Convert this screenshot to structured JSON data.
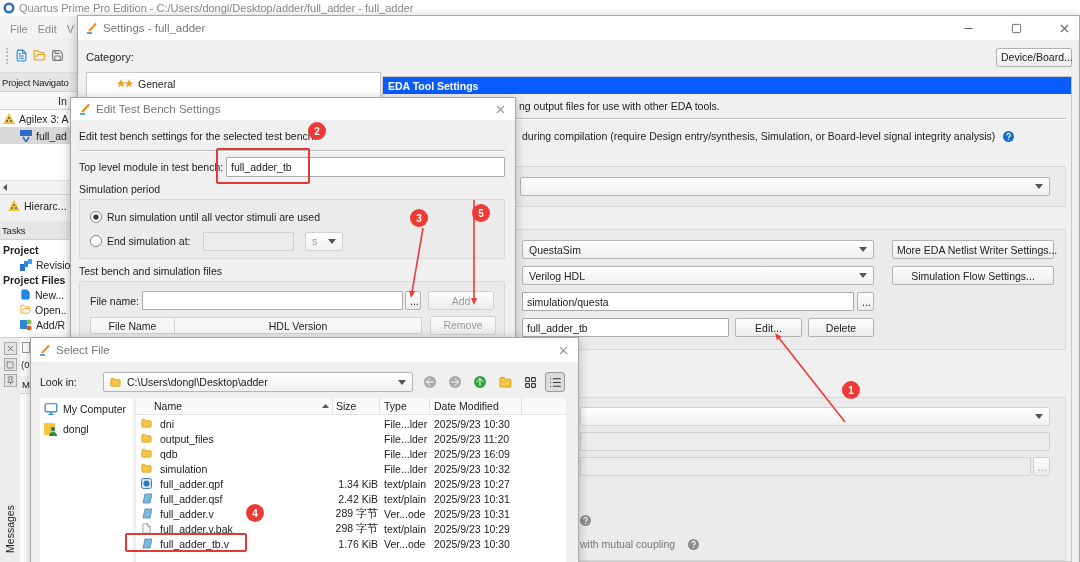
{
  "main_window": {
    "title": "Quartus Prime Pro Edition - C:/Users/dongl/Desktop/adder/full_adder - full_adder",
    "menu": [
      {
        "label": "File"
      },
      {
        "label": "Edit"
      },
      {
        "label": "V"
      }
    ],
    "navigator": {
      "title": "Project Navigato",
      "column": "In",
      "tab": "Hierarc...",
      "items": [
        {
          "label": "Agilex 3: A",
          "kind": "device",
          "selected": false
        },
        {
          "label": "full_ad",
          "kind": "entity",
          "selected": true
        }
      ]
    },
    "tasks": {
      "title": "Tasks",
      "items": [
        {
          "label": "Project",
          "kind": "heading"
        },
        {
          "label": "Revisio",
          "kind": "revisions"
        },
        {
          "label": "Project Files",
          "kind": "heading"
        },
        {
          "label": "New...",
          "kind": "new"
        },
        {
          "label": "Open..",
          "kind": "open"
        },
        {
          "label": "Add/R",
          "kind": "add"
        }
      ]
    },
    "messages": {
      "title": "Messages",
      "checked": false,
      "filter": "(0",
      "column": "M"
    }
  },
  "settings": {
    "title": "Settings - full_adder",
    "category_label": "Category:",
    "device_button": "Device/Board...",
    "categories": [
      {
        "label": "General",
        "selected": false
      }
    ],
    "page_title": "EDA Tool Settings",
    "intro": "ng output files for use with other EDA tools.",
    "note": "during compilation (require Design entry/synthesis, Simulation, or Board-level signal integrity analysis)",
    "simulation": {
      "tool": "QuestaSim",
      "format": "Verilog HDL",
      "output_directory": "simulation/questa",
      "test_bench": "full_adder_tb",
      "browse_button": "...",
      "edit_button": "Edit...",
      "delete_button": "Delete",
      "more_button": "More EDA Netlist Writer Settings...",
      "flow_button": "Simulation Flow Settings..."
    },
    "board": {
      "browse_button": "...",
      "coupling_note": "with mutual coupling"
    }
  },
  "test_bench_dialog": {
    "title": "Edit Test Bench Settings",
    "description": "Edit test bench settings for the selected test bench.",
    "top_module": {
      "label": "Top level module in test bench:",
      "value": "full_adder_tb"
    },
    "period_title": "Simulation period",
    "period_options": [
      {
        "label": "Run simulation until all vector stimuli are used",
        "selected": true
      },
      {
        "label": "End simulation at:",
        "selected": false
      }
    ],
    "end_time_unit": "s",
    "files_title": "Test bench and simulation files",
    "file_name_label": "File name:",
    "browse_button": "...",
    "add_button": {
      "label": "Add",
      "disabled": true
    },
    "remove_button": {
      "label": "Remove",
      "disabled": true
    },
    "columns": [
      "File Name",
      "HDL Version"
    ]
  },
  "select_file_dialog": {
    "title": "Select File",
    "look_in_label": "Look in:",
    "path": "C:\\Users\\dongl\\Desktop\\adder",
    "view_modes": [
      {
        "kind": "grid",
        "selected": false
      },
      {
        "kind": "list",
        "selected": true
      }
    ],
    "places": [
      {
        "label": "My Computer",
        "kind": "computer"
      },
      {
        "label": "dongl",
        "kind": "user"
      }
    ],
    "columns": [
      "Name",
      "Size",
      "Type",
      "Date Modified"
    ],
    "files": [
      {
        "name": "dni",
        "kind": "folder",
        "type": "File...lder",
        "modified": "2025/9/23 10:30"
      },
      {
        "name": "output_files",
        "kind": "folder",
        "type": "File...lder",
        "modified": "2025/9/23 11:20"
      },
      {
        "name": "qdb",
        "kind": "folder",
        "type": "File...lder",
        "modified": "2025/9/23 16:09"
      },
      {
        "name": "simulation",
        "kind": "folder",
        "type": "File...lder",
        "modified": "2025/9/23 10:32"
      },
      {
        "name": "full_adder.qpf",
        "kind": "project",
        "size": "1.34 KiB",
        "type": "text/plain",
        "modified": "2025/9/23 10:27"
      },
      {
        "name": "full_adder.qsf",
        "kind": "source",
        "size": "2.42 KiB",
        "type": "text/plain",
        "modified": "2025/9/23 10:31"
      },
      {
        "name": "full_adder.v",
        "kind": "source",
        "size": "289 字节",
        "type": "Ver...ode",
        "modified": "2025/9/23 10:31"
      },
      {
        "name": "full_adder.v.bak",
        "kind": "text",
        "size": "298 字节",
        "type": "text/plain",
        "modified": "2025/9/23 10:29"
      },
      {
        "name": "full_adder_tb.v",
        "kind": "source",
        "size": "1.76 KiB",
        "type": "Ver...ode",
        "modified": "2025/9/23 10:30"
      }
    ]
  },
  "annotations": [
    {
      "kind": "badge",
      "label": "2"
    },
    {
      "kind": "frame"
    },
    {
      "kind": "arrow"
    },
    {
      "kind": "badge",
      "label": "5"
    },
    {
      "kind": "badge",
      "label": "3"
    },
    {
      "kind": "arrow"
    },
    {
      "kind": "badge",
      "label": "1"
    },
    {
      "kind": "arrow"
    },
    {
      "kind": "badge",
      "label": "4"
    },
    {
      "kind": "frame"
    }
  ]
}
